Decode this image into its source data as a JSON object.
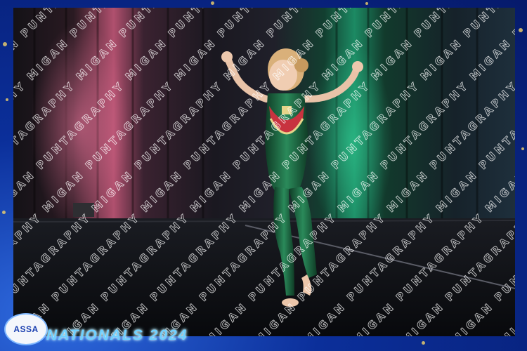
{
  "photo": {
    "subject": "child-dancer",
    "costume_color": "#1f6b3f"
  },
  "watermark": {
    "text": "MIGAN PUNTAGRAPHY"
  },
  "branding": {
    "logo_text": "ASSA",
    "event_title": "NATIONALS 2024"
  },
  "colors": {
    "frame_blue": "#0b2f9a",
    "sparkle_gold": "#f2d36b",
    "title_cyan": "#6fd0ff"
  }
}
